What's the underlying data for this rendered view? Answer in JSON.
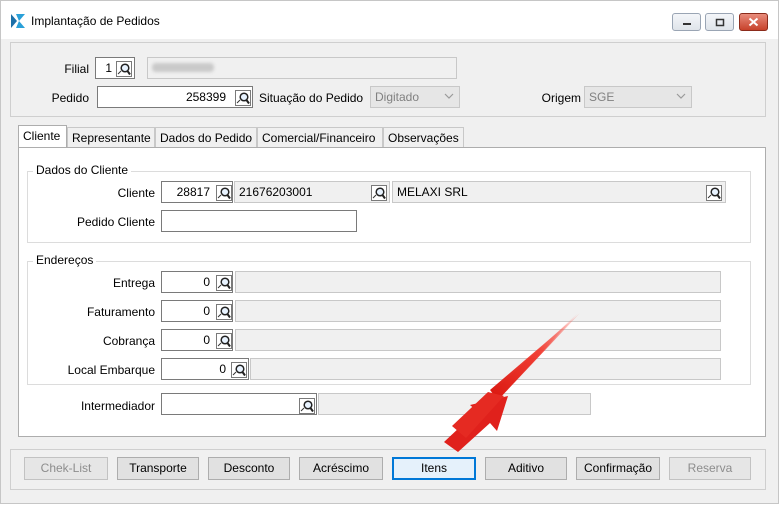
{
  "window": {
    "title": "Implantação de Pedidos"
  },
  "header": {
    "filial_label": "Filial",
    "filial_value": "1",
    "pedido_label": "Pedido",
    "pedido_value": "258399",
    "situacao_label": "Situação do Pedido",
    "situacao_value": "Digitado",
    "origem_label": "Origem",
    "origem_value": "SGE"
  },
  "tabs": [
    {
      "label": "Cliente"
    },
    {
      "label": "Representante"
    },
    {
      "label": "Dados do Pedido"
    },
    {
      "label": "Comercial/Financeiro"
    },
    {
      "label": "Observações"
    }
  ],
  "dados_cliente": {
    "group_title": "Dados do Cliente",
    "cliente_label": "Cliente",
    "cliente_code": "28817",
    "cliente_doc": "21676203001",
    "cliente_name": "MELAXI SRL",
    "pedido_cliente_label": "Pedido Cliente",
    "pedido_cliente_value": ""
  },
  "enderecos": {
    "group_title": "Endereços",
    "rows": [
      {
        "label": "Entrega",
        "value": "0"
      },
      {
        "label": "Faturamento",
        "value": "0"
      },
      {
        "label": "Cobrança",
        "value": "0"
      },
      {
        "label": "Local Embarque",
        "value": "0"
      }
    ]
  },
  "intermediador": {
    "label": "Intermediador",
    "value": ""
  },
  "buttons": {
    "checklist": "Chek-List",
    "transporte": "Transporte",
    "desconto": "Desconto",
    "acrescimo": "Acréscimo",
    "itens": "Itens",
    "aditivo": "Aditivo",
    "confirmacao": "Confirmação",
    "reserva": "Reserva"
  },
  "icons": {
    "lookup": "magnifier-lookup-icon",
    "minimize": "minimize-icon",
    "maximize": "maximize-icon",
    "close": "close-icon"
  },
  "colors": {
    "accent": "#0078d7",
    "close_button": "#c7422b",
    "annotation_arrow": "#e0211c"
  }
}
